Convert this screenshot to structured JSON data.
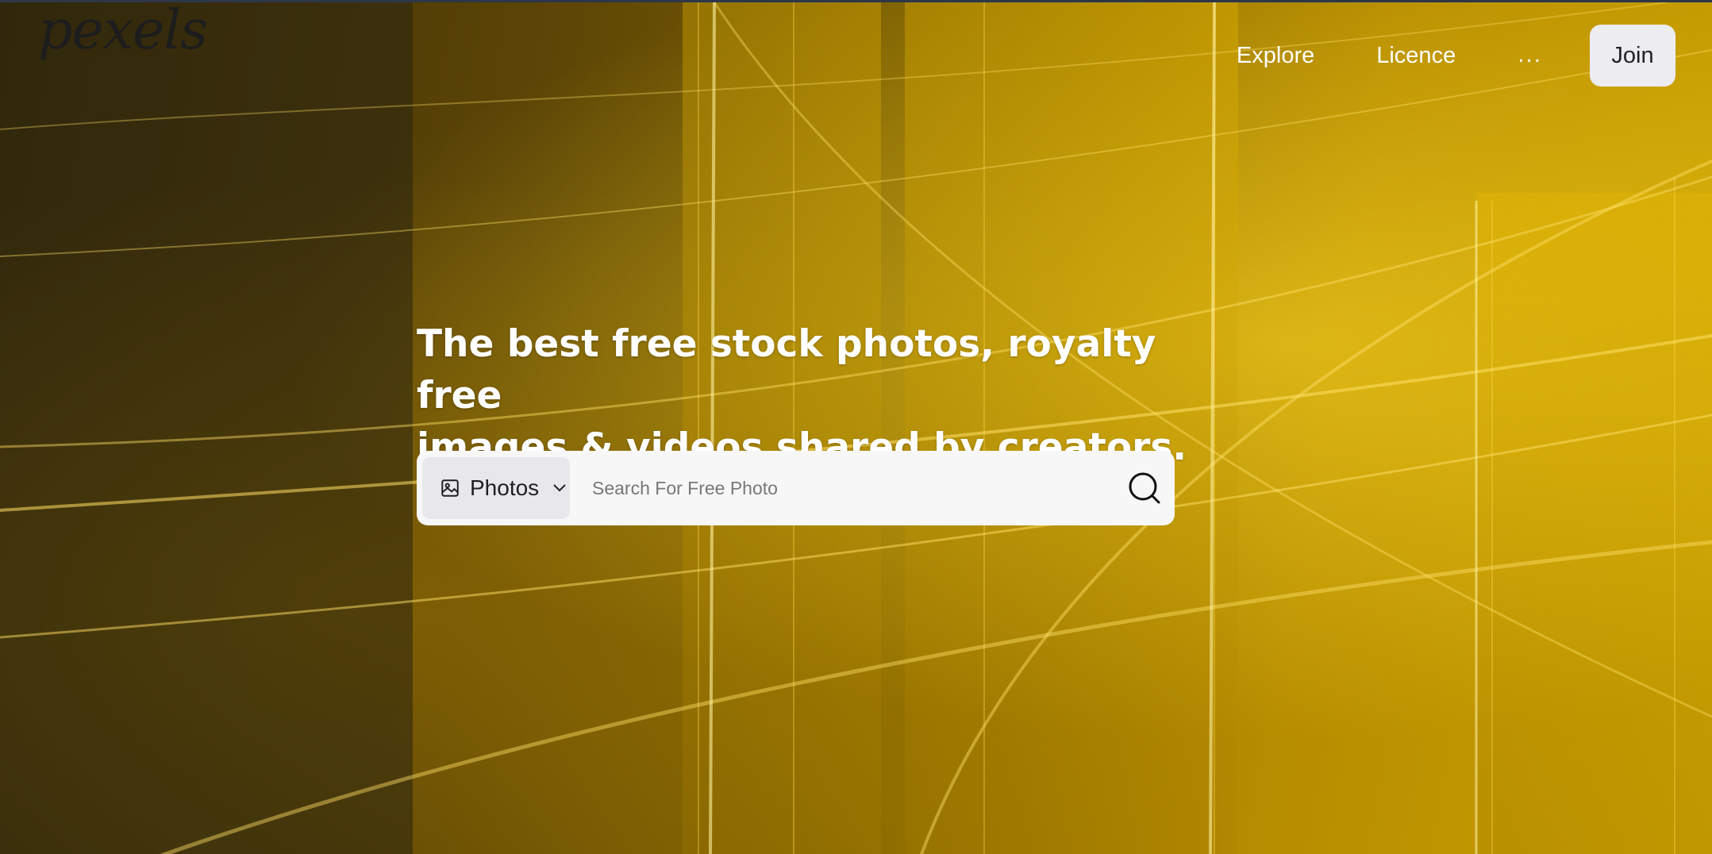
{
  "brand": {
    "logo_text": "pexels"
  },
  "nav": {
    "explore": "Explore",
    "licence": "Licence",
    "more": "...",
    "join": "Join"
  },
  "hero": {
    "headline_line1": "The best free stock photos, royalty free",
    "headline_line2": "images & videos shared by creators."
  },
  "search": {
    "type_label": "Photos",
    "placeholder": "Search For Free Photo",
    "value": ""
  },
  "icons": {
    "type": "image-icon",
    "dropdown": "chevron-down-icon",
    "submit": "search-icon"
  },
  "colors": {
    "accent_light": "#f5c400",
    "search_bg": "#f7f7f7",
    "join_bg": "#ececf1"
  }
}
